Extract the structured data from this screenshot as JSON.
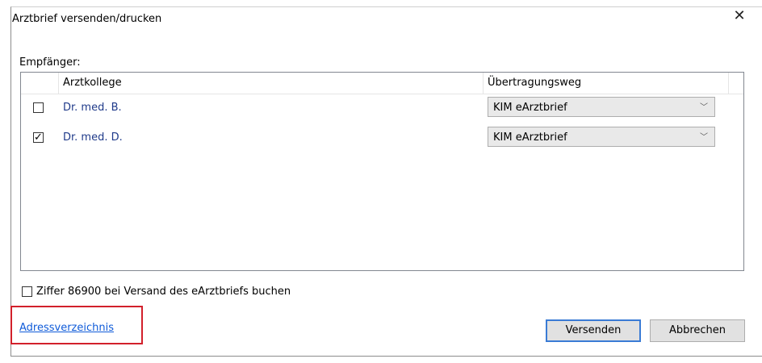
{
  "window": {
    "title": "Arztbrief versenden/drucken",
    "close_symbol": "✕"
  },
  "recipients": {
    "label": "Empfänger:",
    "columns": {
      "colleague": "Arztkollege",
      "channel": "Übertragungsweg"
    },
    "rows": [
      {
        "name": "Dr. med. B.",
        "checked": false,
        "channel": "KIM eArztbrief"
      },
      {
        "name": "Dr. med. D.",
        "checked": true,
        "channel": "KIM eArztbrief"
      }
    ]
  },
  "option": {
    "label": "Ziffer 86900 bei Versand des eArztbriefs buchen",
    "checked": false
  },
  "link": {
    "label": "Adressverzeichnis"
  },
  "buttons": {
    "send": "Versenden",
    "cancel": "Abbrechen"
  },
  "icons": {
    "checkbox_checked": "check-icon",
    "dropdown": "chevron-down-icon",
    "close": "close-icon"
  },
  "colors": {
    "highlight_border": "#d2202b",
    "link": "#0f5bd9",
    "name_text": "#1f3a8a"
  }
}
